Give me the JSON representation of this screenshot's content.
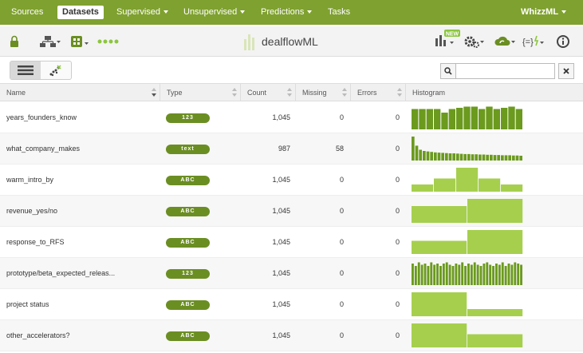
{
  "nav": {
    "items": [
      {
        "label": "Sources",
        "active": false,
        "dropdown": false
      },
      {
        "label": "Datasets",
        "active": true,
        "dropdown": false
      },
      {
        "label": "Supervised",
        "active": false,
        "dropdown": true
      },
      {
        "label": "Unsupervised",
        "active": false,
        "dropdown": true
      },
      {
        "label": "Predictions",
        "active": false,
        "dropdown": true
      },
      {
        "label": "Tasks",
        "active": false,
        "dropdown": false
      }
    ],
    "user_menu": "WhizzML"
  },
  "toolbar": {
    "title": "dealflowML",
    "new_badge": "NEW",
    "left_icons": [
      "lock-icon",
      "network-icon",
      "source-icon",
      "dots-icon"
    ],
    "right_icons": [
      "new-chart-icon",
      "gears-icon",
      "cloud-icon",
      "formula-icon",
      "info-icon"
    ]
  },
  "filter": {
    "search_placeholder": "",
    "search_icon": "search-icon",
    "clear_icon": "clear-icon"
  },
  "colors": {
    "brand": "#7fa12f",
    "badge": "#6b8e23",
    "hist_dark": "#6b9a1e",
    "hist_light": "#a6cf4e"
  },
  "table": {
    "columns": [
      "Name",
      "Type",
      "Count",
      "Missing",
      "Errors",
      "Histogram"
    ],
    "rows": [
      {
        "name": "years_founders_know",
        "type": "123",
        "count": "1,045",
        "missing": "0",
        "errors": "0",
        "hist": {
          "color": "dark",
          "values": [
            0.85,
            0.85,
            0.85,
            0.85,
            0.7,
            0.85,
            0.9,
            0.95,
            0.95,
            0.85,
            0.95,
            0.85,
            0.9,
            0.95,
            0.85
          ]
        }
      },
      {
        "name": "what_company_makes",
        "type": "text",
        "count": "987",
        "missing": "58",
        "errors": "0",
        "hist": {
          "color": "dark",
          "values": [
            1.0,
            0.62,
            0.45,
            0.4,
            0.38,
            0.36,
            0.34,
            0.33,
            0.32,
            0.31,
            0.3,
            0.3,
            0.29,
            0.28,
            0.27,
            0.27,
            0.26,
            0.26,
            0.25,
            0.25,
            0.24,
            0.24,
            0.23,
            0.23,
            0.22,
            0.22,
            0.22,
            0.21,
            0.21,
            0.2
          ]
        }
      },
      {
        "name": "warm_intro_by",
        "type": "ABC",
        "count": "1,045",
        "missing": "0",
        "errors": "0",
        "hist": {
          "color": "light",
          "values": [
            0.3,
            0.55,
            1.0,
            0.55,
            0.3
          ]
        }
      },
      {
        "name": "revenue_yes/no",
        "type": "ABC",
        "count": "1,045",
        "missing": "0",
        "errors": "0",
        "hist": {
          "color": "light",
          "values": [
            0.7,
            1.0
          ]
        }
      },
      {
        "name": "response_to_RFS",
        "type": "ABC",
        "count": "1,045",
        "missing": "0",
        "errors": "0",
        "hist": {
          "color": "light",
          "values": [
            0.55,
            1.0
          ]
        }
      },
      {
        "name": "prototype/beta_expected_releas...",
        "type": "123",
        "count": "1,045",
        "missing": "0",
        "errors": "0",
        "hist": {
          "color": "dark",
          "values": [
            0.9,
            0.8,
            0.95,
            0.85,
            0.9,
            0.8,
            0.95,
            0.85,
            0.9,
            0.8,
            0.9,
            0.95,
            0.85,
            0.8,
            0.9,
            0.85,
            0.95,
            0.8,
            0.9,
            0.85,
            0.95,
            0.85,
            0.8,
            0.9,
            0.95,
            0.85,
            0.8,
            0.9,
            0.85,
            0.95,
            0.8,
            0.9,
            0.85,
            0.95,
            0.9,
            0.85
          ]
        }
      },
      {
        "name": "project status",
        "type": "ABC",
        "count": "1,045",
        "missing": "0",
        "errors": "0",
        "hist": {
          "color": "light",
          "values": [
            1.0,
            0.3
          ]
        }
      },
      {
        "name": "other_accelerators?",
        "type": "ABC",
        "count": "1,045",
        "missing": "0",
        "errors": "0",
        "hist": {
          "color": "light",
          "values": [
            1.0,
            0.55
          ]
        }
      }
    ]
  }
}
